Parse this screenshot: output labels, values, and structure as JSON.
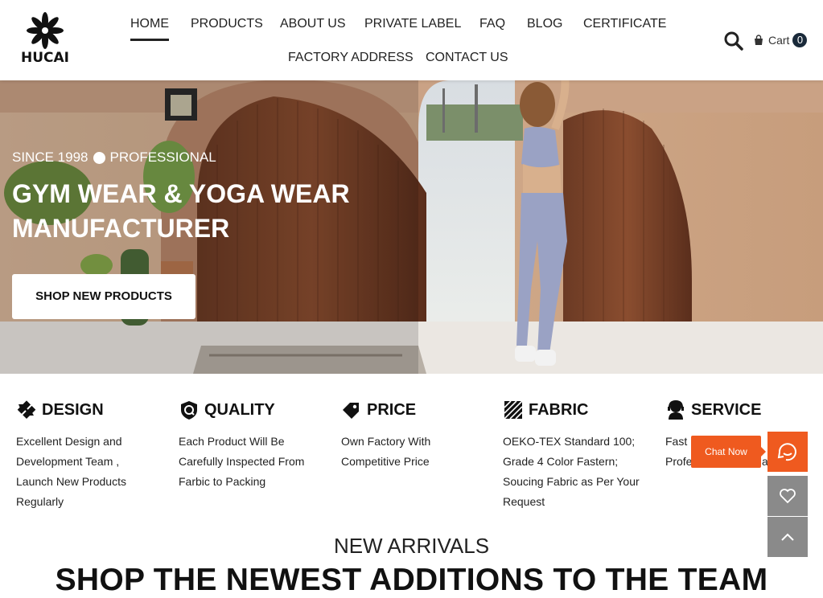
{
  "brand": {
    "logo_text": "HUCAI"
  },
  "nav": {
    "items": [
      {
        "label": "HOME"
      },
      {
        "label": "PRODUCTS"
      },
      {
        "label": "ABOUT US"
      },
      {
        "label": "PRIVATE LABEL"
      },
      {
        "label": "FAQ"
      },
      {
        "label": "BLOG"
      },
      {
        "label": "CERTIFICATE"
      },
      {
        "label": "FACTORY ADDRESS"
      },
      {
        "label": "CONTACT US"
      }
    ],
    "active": "HOME"
  },
  "header_tools": {
    "search_icon": "search-icon",
    "cart_label": "Cart",
    "cart_count": "0"
  },
  "hero": {
    "tag_left": "SINCE 1998",
    "tag_right": "PROFESSIONAL",
    "title_line1": "GYM WEAR & YOGA WEAR",
    "title_line2": "MANUFACTURER",
    "button_label": "SHOP NEW PRODUCTS"
  },
  "features": [
    {
      "title": "DESIGN",
      "icon": "design-icon",
      "lines": [
        "Excellent Design and",
        "Development Team ,",
        "Launch New Products",
        "Regularly"
      ]
    },
    {
      "title": "QUALITY",
      "icon": "quality-icon",
      "lines": [
        "Each Product Will Be",
        "Carefully Inspected From",
        "Farbic to Packing"
      ]
    },
    {
      "title": "PRICE",
      "icon": "price-tag-icon",
      "lines": [
        "Own Factory With",
        "Competitive Price"
      ]
    },
    {
      "title": "FABRIC",
      "icon": "fabric-icon",
      "lines": [
        "OEKO-TEX Standard 100;",
        "Grade 4 Color Fastern;",
        "Soucing Fabric as Per Your",
        "Request"
      ]
    },
    {
      "title": "SERVICE",
      "icon": "service-icon",
      "lines": [
        "Fast D",
        "Profe",
        "at"
      ]
    }
  ],
  "arrivals": {
    "subtitle": "NEW ARRIVALS",
    "title": "SHOP THE NEWEST ADDITIONS TO THE TEAM"
  },
  "floating": {
    "chat_label": "Chat Now",
    "accent": "#ef5a1f",
    "gray": "#8a8a8a"
  }
}
